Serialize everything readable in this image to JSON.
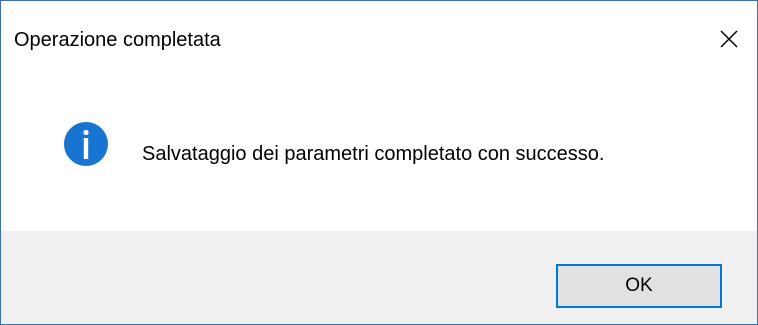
{
  "window": {
    "title": "Operazione completata",
    "close_icon": "close-icon"
  },
  "content": {
    "icon": "information-icon",
    "icon_color": "#1874d1",
    "message": "Salvataggio dei parametri completato con successo."
  },
  "footer": {
    "ok_label": "OK",
    "accent_color": "#0078d7"
  }
}
